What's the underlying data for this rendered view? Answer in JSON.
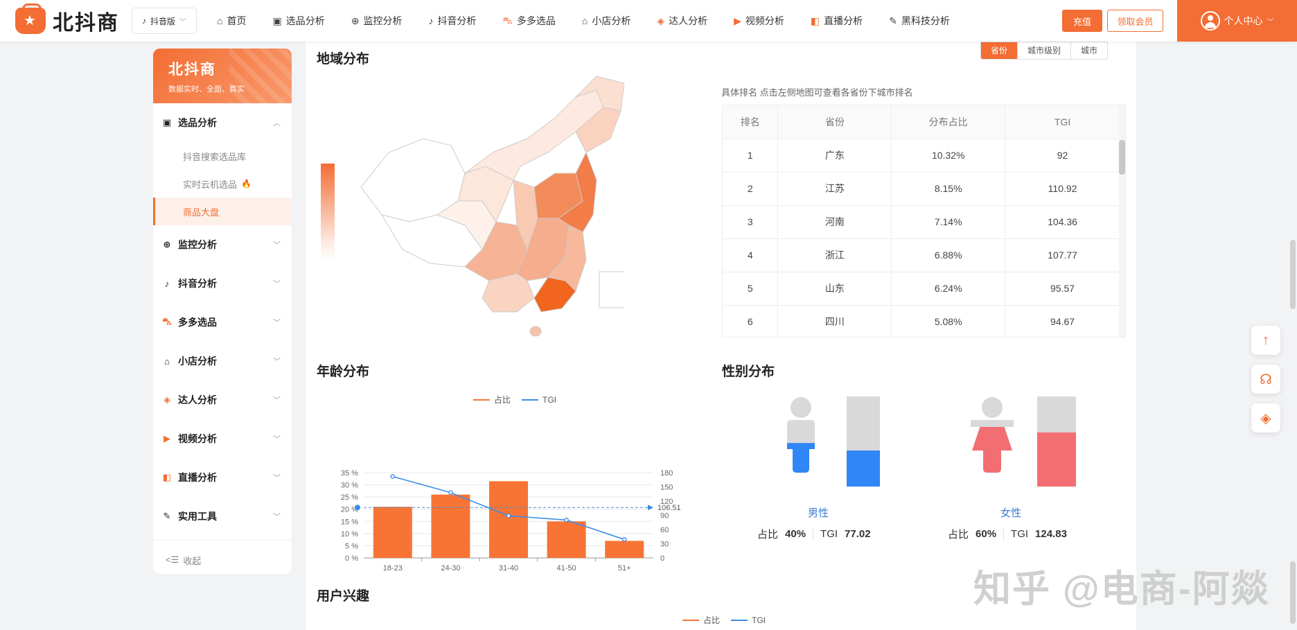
{
  "brand": {
    "name": "北抖商"
  },
  "version_selector": {
    "label": "抖音版"
  },
  "nav": [
    {
      "label": "首页",
      "icon": "home-icon",
      "glyph": "⌂"
    },
    {
      "label": "选品分析",
      "icon": "clipboard-icon",
      "glyph": "▣"
    },
    {
      "label": "监控分析",
      "icon": "crosshair-icon",
      "glyph": "⊕"
    },
    {
      "label": "抖音分析",
      "icon": "tiktok-icon",
      "glyph": "♪"
    },
    {
      "label": "多多选品",
      "icon": "bag-icon",
      "glyph": "⛍"
    },
    {
      "label": "小店分析",
      "icon": "shop-icon",
      "glyph": "⌂"
    },
    {
      "label": "达人分析",
      "icon": "diamond-icon",
      "glyph": "◈"
    },
    {
      "label": "视频分析",
      "icon": "video-icon",
      "glyph": "▶"
    },
    {
      "label": "直播分析",
      "icon": "live-icon",
      "glyph": "◧"
    },
    {
      "label": "黑科技分析",
      "icon": "wrench-icon",
      "glyph": "✎"
    }
  ],
  "header_actions": {
    "recharge": "充值",
    "member": "领取会员",
    "user_center": "个人中心"
  },
  "sidebar": {
    "title": "北抖商",
    "subtitle": "数据实时、全面、真实",
    "groups": [
      {
        "label": "选品分析",
        "icon": "clipboard-icon",
        "glyph": "▣",
        "expanded": true,
        "items": [
          {
            "label": "抖音搜索选品库",
            "active": false
          },
          {
            "label": "实时云机选品",
            "active": false,
            "hot": true
          },
          {
            "label": "商品大盘",
            "active": true
          }
        ]
      },
      {
        "label": "监控分析",
        "icon": "crosshair-icon",
        "glyph": "⊕"
      },
      {
        "label": "抖音分析",
        "icon": "tiktok-icon",
        "glyph": "♪"
      },
      {
        "label": "多多选品",
        "icon": "bag-icon",
        "glyph": "⛍"
      },
      {
        "label": "小店分析",
        "icon": "shop-icon",
        "glyph": "⌂"
      },
      {
        "label": "达人分析",
        "icon": "diamond-icon",
        "glyph": "◈"
      },
      {
        "label": "视频分析",
        "icon": "video-icon",
        "glyph": "▶"
      },
      {
        "label": "直播分析",
        "icon": "live-icon",
        "glyph": "◧"
      },
      {
        "label": "实用工具",
        "icon": "wrench-icon",
        "glyph": "✎"
      }
    ],
    "collapse_label": "收起"
  },
  "region": {
    "title": "地域分布",
    "tabs": [
      {
        "label": "省份",
        "active": true
      },
      {
        "label": "城市级别"
      },
      {
        "label": "城市"
      }
    ],
    "hint": "具体排名 点击左侧地图可查看各省份下城市排名",
    "columns": [
      "排名",
      "省份",
      "分布占比",
      "TGI"
    ],
    "rows": [
      [
        "1",
        "广东",
        "10.32%",
        "92"
      ],
      [
        "2",
        "江苏",
        "8.15%",
        "110.92"
      ],
      [
        "3",
        "河南",
        "7.14%",
        "104.36"
      ],
      [
        "4",
        "浙江",
        "6.88%",
        "107.77"
      ],
      [
        "5",
        "山东",
        "6.24%",
        "95.57"
      ],
      [
        "6",
        "四川",
        "5.08%",
        "94.67"
      ]
    ]
  },
  "age": {
    "title": "年龄分布",
    "chart_data": {
      "type": "bar",
      "categories": [
        "18-23",
        "24-30",
        "31-40",
        "41-50",
        "51+"
      ],
      "series": [
        {
          "name": "占比",
          "axis": "left",
          "type": "bar",
          "color": "#f87434",
          "values": [
            21,
            26,
            31.5,
            15,
            7
          ]
        },
        {
          "name": "TGI",
          "axis": "right",
          "type": "line",
          "color": "#3a8ee6",
          "values": [
            172,
            138,
            89,
            80,
            39
          ]
        }
      ],
      "left_axis": {
        "min": 0,
        "max": 35,
        "ticks": [
          "0 %",
          "5 %",
          "10 %",
          "15 %",
          "20 %",
          "25 %",
          "30 %",
          "35 %"
        ]
      },
      "right_axis": {
        "min": 0,
        "max": 180,
        "ticks": [
          "0",
          "30",
          "60",
          "90",
          "120",
          "150",
          "180"
        ]
      },
      "markline": {
        "value": 106.51,
        "label": "106.51",
        "axis": "right"
      }
    }
  },
  "gender": {
    "title": "性别分布",
    "male": {
      "label": "男性",
      "ratio_label": "占比",
      "ratio": "40%",
      "tgi_label": "TGI",
      "tgi": "77.02",
      "fill": 0.4,
      "color": "#2f86f6"
    },
    "female": {
      "label": "女性",
      "ratio_label": "占比",
      "ratio": "60%",
      "tgi_label": "TGI",
      "tgi": "124.83",
      "fill": 0.6,
      "color": "#f36e72"
    }
  },
  "interest": {
    "title": "用户兴趣",
    "legend": [
      {
        "name": "占比",
        "color": "#f87434"
      },
      {
        "name": "TGI",
        "color": "#3a8ee6"
      }
    ]
  },
  "watermark": "知乎 @电商-阿燚",
  "colors": {
    "accent": "#f36d34"
  }
}
